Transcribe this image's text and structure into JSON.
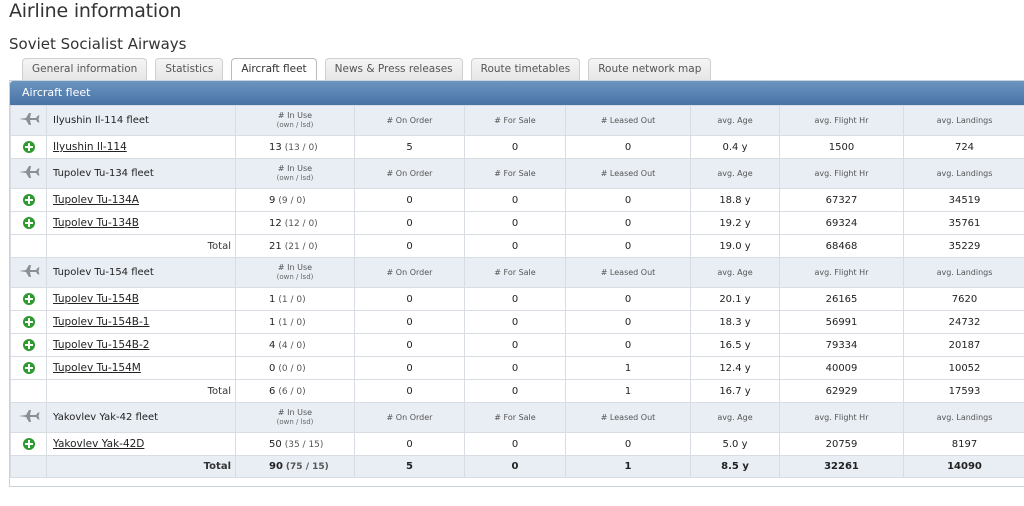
{
  "page": {
    "title": "Airline information",
    "airline_name": "Soviet Socialist Airways"
  },
  "tabs": [
    {
      "label": "General information",
      "active": false
    },
    {
      "label": "Statistics",
      "active": false
    },
    {
      "label": "Aircraft fleet",
      "active": true
    },
    {
      "label": "News & Press releases",
      "active": false
    },
    {
      "label": "Route timetables",
      "active": false
    },
    {
      "label": "Route network map",
      "active": false
    }
  ],
  "panel": {
    "title": "Aircraft fleet"
  },
  "columns": {
    "in_use": "# In Use",
    "in_use_sub": "(own / lsd)",
    "on_order": "# On Order",
    "for_sale": "# For Sale",
    "leased_out": "# Leased Out",
    "avg_age": "avg. Age",
    "avg_flight_hr": "avg. Flight Hr",
    "avg_landings": "avg. Landings"
  },
  "total_label": "Total",
  "groups": [
    {
      "name": "Ilyushin Il-114 fleet",
      "models": [
        {
          "name": "Ilyushin Il-114",
          "in_use": "13",
          "own_lsd": "(13 / 0)",
          "on_order": "5",
          "for_sale": "0",
          "leased_out": "0",
          "avg_age": "0.4 y",
          "flight_hr": "1500",
          "landings": "724"
        }
      ],
      "total": null
    },
    {
      "name": "Tupolev Tu-134 fleet",
      "models": [
        {
          "name": "Tupolev Tu-134A",
          "in_use": "9",
          "own_lsd": "(9 / 0)",
          "on_order": "0",
          "for_sale": "0",
          "leased_out": "0",
          "avg_age": "18.8 y",
          "flight_hr": "67327",
          "landings": "34519"
        },
        {
          "name": "Tupolev Tu-134B",
          "in_use": "12",
          "own_lsd": "(12 / 0)",
          "on_order": "0",
          "for_sale": "0",
          "leased_out": "0",
          "avg_age": "19.2 y",
          "flight_hr": "69324",
          "landings": "35761"
        }
      ],
      "total": {
        "in_use": "21",
        "own_lsd": "(21 / 0)",
        "on_order": "0",
        "for_sale": "0",
        "leased_out": "0",
        "avg_age": "19.0 y",
        "flight_hr": "68468",
        "landings": "35229"
      }
    },
    {
      "name": "Tupolev Tu-154 fleet",
      "models": [
        {
          "name": "Tupolev Tu-154B",
          "in_use": "1",
          "own_lsd": "(1 / 0)",
          "on_order": "0",
          "for_sale": "0",
          "leased_out": "0",
          "avg_age": "20.1 y",
          "flight_hr": "26165",
          "landings": "7620"
        },
        {
          "name": "Tupolev Tu-154B-1",
          "in_use": "1",
          "own_lsd": "(1 / 0)",
          "on_order": "0",
          "for_sale": "0",
          "leased_out": "0",
          "avg_age": "18.3 y",
          "flight_hr": "56991",
          "landings": "24732"
        },
        {
          "name": "Tupolev Tu-154B-2",
          "in_use": "4",
          "own_lsd": "(4 / 0)",
          "on_order": "0",
          "for_sale": "0",
          "leased_out": "0",
          "avg_age": "16.5 y",
          "flight_hr": "79334",
          "landings": "20187"
        },
        {
          "name": "Tupolev Tu-154M",
          "in_use": "0",
          "own_lsd": "(0 / 0)",
          "on_order": "0",
          "for_sale": "0",
          "leased_out": "1",
          "avg_age": "12.4 y",
          "flight_hr": "40009",
          "landings": "10052"
        }
      ],
      "total": {
        "in_use": "6",
        "own_lsd": "(6 / 0)",
        "on_order": "0",
        "for_sale": "0",
        "leased_out": "1",
        "avg_age": "16.7 y",
        "flight_hr": "62929",
        "landings": "17593"
      }
    },
    {
      "name": "Yakovlev Yak-42 fleet",
      "models": [
        {
          "name": "Yakovlev Yak-42D",
          "in_use": "50",
          "own_lsd": "(35 / 15)",
          "on_order": "0",
          "for_sale": "0",
          "leased_out": "0",
          "avg_age": "5.0 y",
          "flight_hr": "20759",
          "landings": "8197"
        }
      ],
      "total": null
    }
  ],
  "grand_total": {
    "label": "Total",
    "in_use": "90",
    "own_lsd": "(75 / 15)",
    "on_order": "5",
    "for_sale": "0",
    "leased_out": "1",
    "avg_age": "8.5 y",
    "flight_hr": "32261",
    "landings": "14090"
  },
  "icons": {
    "group": "airplane-icon",
    "model": "add-icon"
  },
  "colors": {
    "panel_header": "#4f7aab",
    "group_row": "#e9eef5",
    "add_icon": "#2f9a2f"
  }
}
